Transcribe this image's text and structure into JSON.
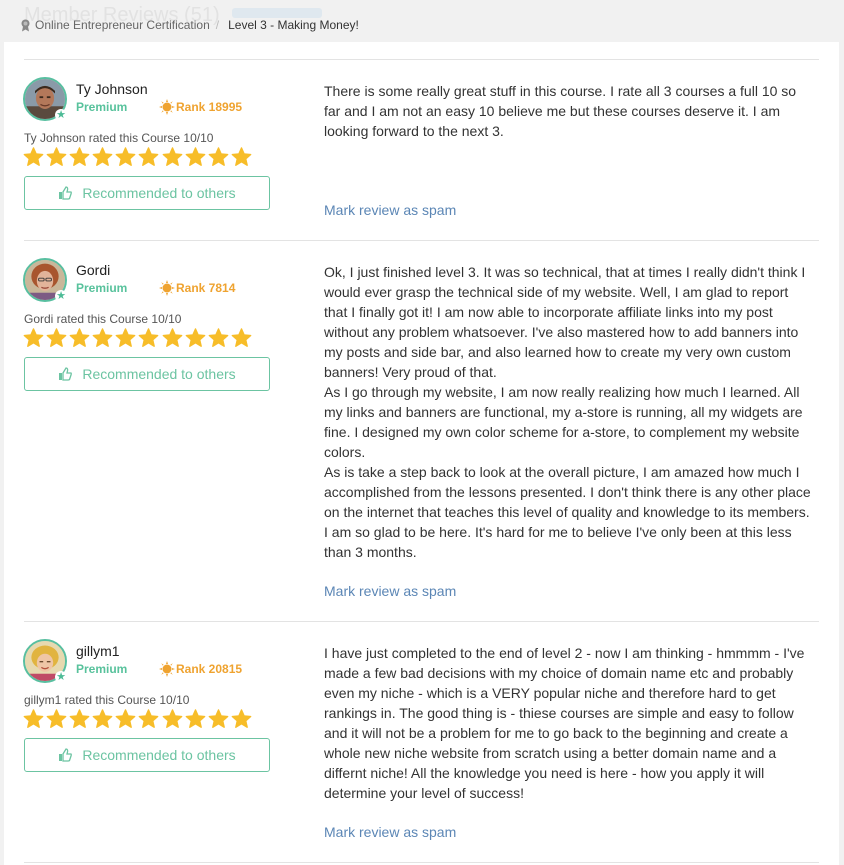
{
  "header": {
    "section_title": "Member Reviews (51)",
    "breadcrumb": [
      "Online Entrepreneur Certification",
      "Level 3 - Making Money!"
    ]
  },
  "reviews": [
    {
      "name": "Ty Johnson",
      "level": "Premium",
      "rank": "Rank 18995",
      "rated_text": "Ty Johnson rated this Course 10/10",
      "rating": 10,
      "recommend_label": "Recommended to others",
      "paragraphs": [
        "There is some really great stuff in this course. I rate all 3 courses a full 10 so far and I am not an easy 10 believe me but these courses deserve it. I am looking forward to the next 3."
      ],
      "spam_label": "Mark review as spam"
    },
    {
      "name": "Gordi",
      "level": "Premium",
      "rank": "Rank 7814",
      "rated_text": "Gordi rated this Course 10/10",
      "rating": 10,
      "recommend_label": "Recommended to others",
      "paragraphs": [
        "Ok, I just finished level 3. It was so technical, that at times I really didn't think I would ever grasp the technical side of my website. Well, I am glad to report that I finally got it! I am now able to incorporate affiliate links into my post without any problem whatsoever. I've also mastered how to add banners into my posts and side bar, and also learned how to create my very own custom banners! Very proud of that.",
        "As I go through my website, I am now really realizing how much I learned. All my links and banners are functional, my a-store is running, all my widgets are fine. I designed my own color scheme for a-store, to complement my website colors.",
        "As is take a step back to look at the overall picture, I am amazed how much I accomplished from the lessons presented. I don't think there is any other place on the internet that teaches this level of quality and knowledge to its members. I am so glad to be here. It's hard for me to believe I've only been at this less than 3 months."
      ],
      "spam_label": "Mark review as spam"
    },
    {
      "name": "gillym1",
      "level": "Premium",
      "rank": "Rank 20815",
      "rated_text": "gillym1 rated this Course 10/10",
      "rating": 10,
      "recommend_label": "Recommended to others",
      "paragraphs": [
        "I have just completed to the end of level 2 - now I am thinking - hmmmm - I've made a few bad decisions with my choice of domain name etc and probably even my niche - which is a VERY popular niche and therefore hard to get rankings in. The good thing is - thiese courses are simple and easy to follow and it will not be a problem for me to go back to the beginning and create a whole new niche website from scratch using a better domain name and a differnt niche! All the knowledge you need is here - how you apply it will determine your level of success!"
      ],
      "spam_label": "Mark review as spam"
    }
  ],
  "colors": {
    "accent_green": "#58c29c",
    "rank_orange": "#efa330",
    "star_yellow": "#f7bd29",
    "link_blue": "#5b86b5"
  }
}
